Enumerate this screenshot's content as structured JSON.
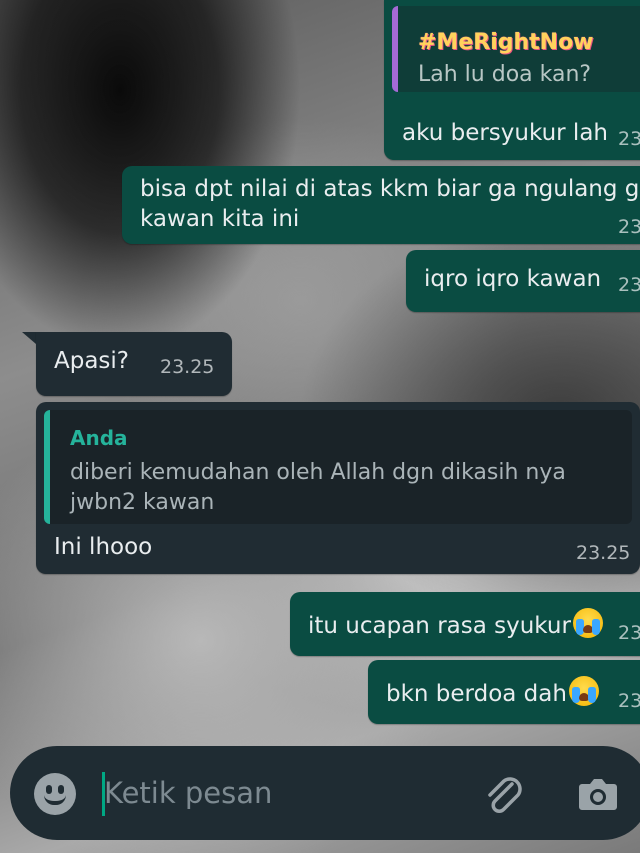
{
  "messages": {
    "m1": {
      "quote_author": "#MeRightNow",
      "quote_text": "Lah lu doa kan?",
      "text": "aku bersyukur lah",
      "time": "23"
    },
    "m2": {
      "line1": "bisa dpt nilai di atas kkm biar ga ngulang gar",
      "line2": "kawan kita ini",
      "time": "23"
    },
    "m3": {
      "text": "iqro iqro kawan",
      "time": "23"
    },
    "m4": {
      "text": "Apasi?",
      "time": "23.25"
    },
    "m5": {
      "quote_author": "Anda",
      "quote_line1": "diberi kemudahan oleh Allah dgn dikasih nya",
      "quote_line2": "jwbn2 kawan",
      "text": "Ini lhooo",
      "time": "23.25"
    },
    "m6": {
      "text": "itu ucapan rasa syukur",
      "time": "23"
    },
    "m7": {
      "text": "bkn berdoa dah",
      "time": "23"
    }
  },
  "emoji": "loudly-crying-face",
  "composer": {
    "placeholder": "Ketik pesan"
  },
  "icons": {
    "emoji_button": "smiley-icon",
    "attach_button": "paperclip-icon",
    "camera_button": "camera-icon"
  },
  "colors": {
    "outgoing_bubble": "#0a4c42",
    "incoming_bubble": "#202c33",
    "quote_accent_purple": "#a56ad6",
    "quote_accent_green": "#25b39b",
    "composer_bg": "#1f2c33"
  }
}
